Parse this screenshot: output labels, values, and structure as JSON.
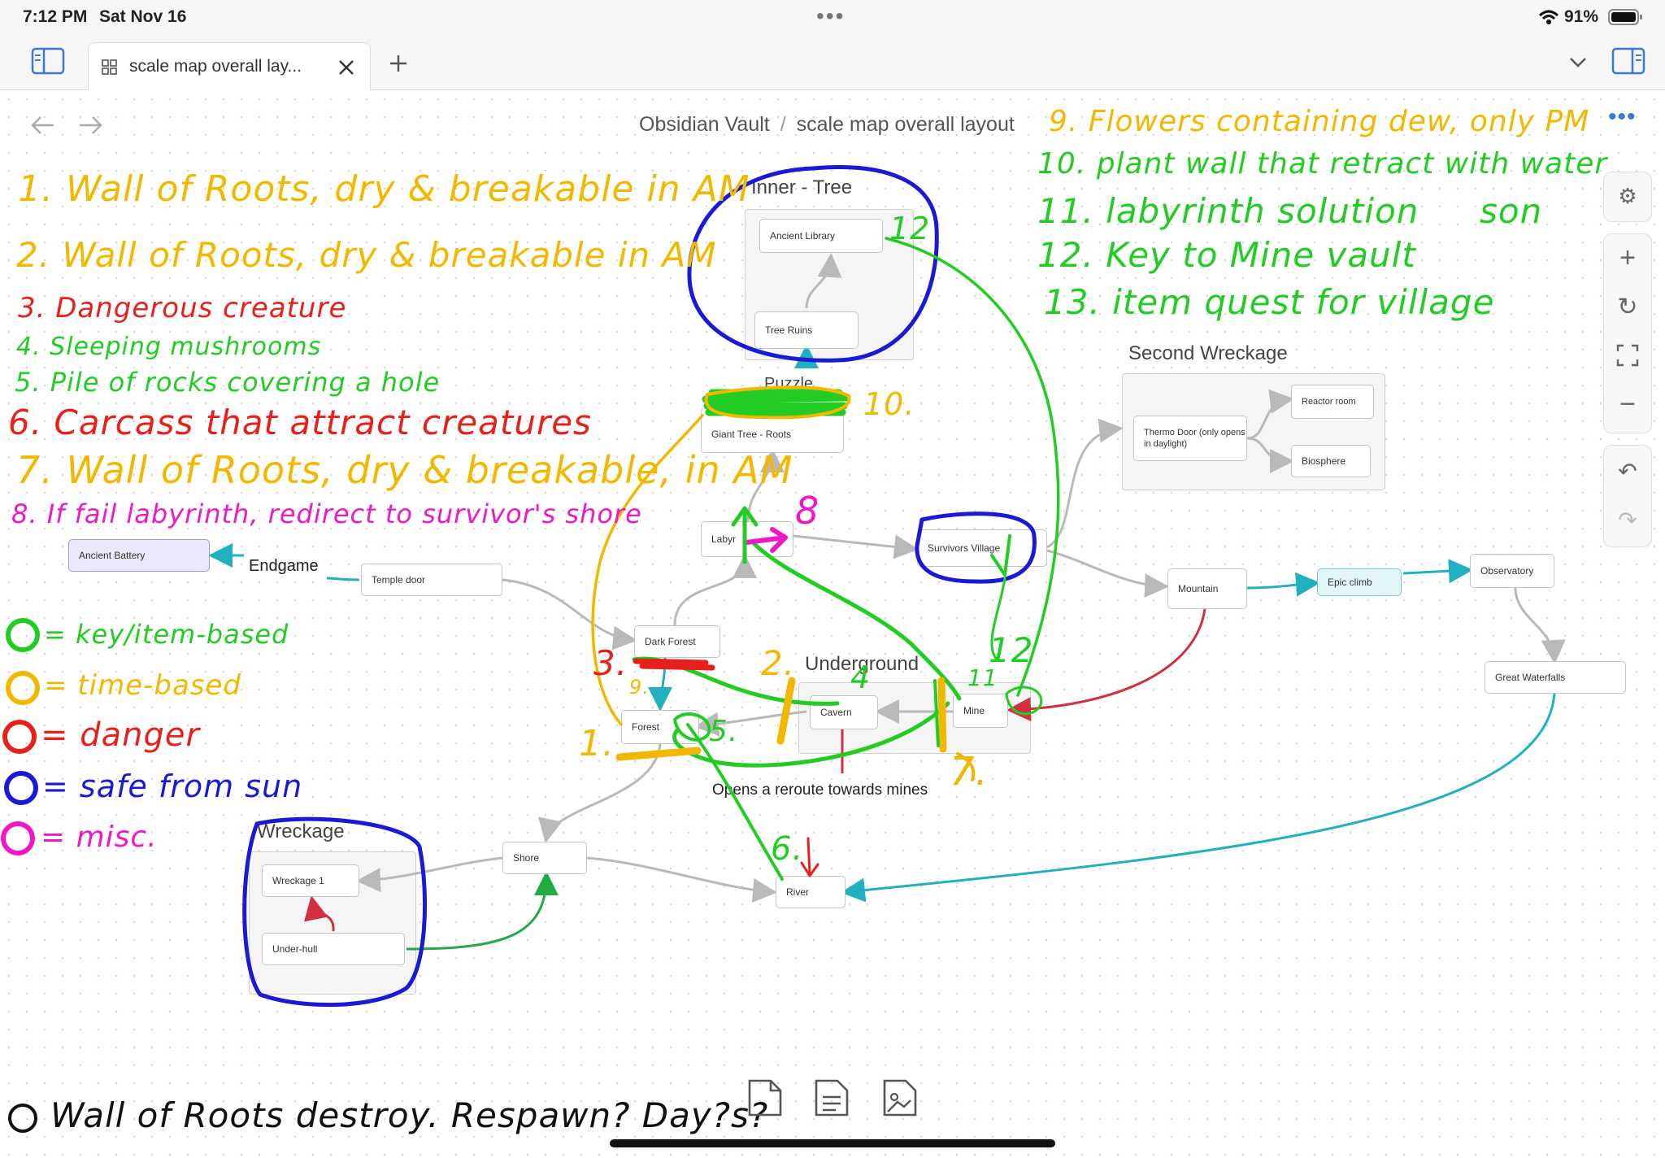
{
  "status": {
    "time": "7:12 PM",
    "date": "Sat Nov 16",
    "battery": "91%"
  },
  "tab": {
    "title": "scale map overall lay..."
  },
  "breadcrumb": {
    "vault": "Obsidian Vault",
    "separator": "/",
    "page": "scale map overall layout"
  },
  "groups": {
    "inner_tree": "Inner - Tree",
    "puzzle": "Puzzle",
    "second_wreckage": "Second Wreckage",
    "underground": "Underground",
    "wreckage": "Wreckage",
    "endgame": "Endgame"
  },
  "nodes": {
    "ancient_library": "Ancient Library",
    "tree_ruins": "Tree Ruins",
    "giant_tree_roots": "Giant Tree - Roots",
    "thermo_door": "Thermo Door (only opens in daylight)",
    "reactor_room": "Reactor room",
    "biosphere": "Biosphere",
    "labyrinth": "Labyr",
    "survivors_village": "Survivors Village",
    "ancient_battery": "Ancient Battery",
    "temple_door": "Temple door",
    "mountain": "Mountain",
    "epic_climb": "Epic climb",
    "observatory": "Observatory",
    "dark_forest": "Dark Forest",
    "cavern": "Cavern",
    "mine": "Mine",
    "great_waterfalls": "Great Waterfalls",
    "forest": "Forest",
    "shore": "Shore",
    "river": "River",
    "wreckage_1": "Wreckage 1",
    "under_hull": "Under-hull"
  },
  "canvas_text": {
    "reroute_note": "Opens a reroute towards mines"
  },
  "annotations": {
    "left": [
      "1. Wall of Roots, dry & breakable in AM",
      "2. Wall of Roots, dry & breakable in AM",
      "3. Dangerous creature",
      "4. Sleeping mushrooms",
      "5. Pile of rocks covering a hole",
      "6. Carcass that attract creatures",
      "7. Wall of Roots, dry & breakable, in AM",
      "8. If fail labyrinth, redirect to survivor's shore"
    ],
    "right": [
      "9. Flowers containing dew, only PM",
      "10. plant wall that retract with water",
      "11. labyrinth solution",
      "son",
      "12. Key to Mine vault",
      "13. item quest for village"
    ],
    "legend": [
      "= key/item-based",
      "= time-based",
      "= danger",
      "= safe from sun",
      "= misc."
    ],
    "markers": {
      "m1": "1.",
      "m2": "2.",
      "m3": "3.",
      "m4": "4",
      "m5": "5.",
      "m6": "6.",
      "m7": "7.",
      "m8": "8",
      "m9": "9.",
      "m10": "10.",
      "m11": "11",
      "m12": "12",
      "m12b": "12"
    },
    "bottom_note": "Wall of Roots destroy. Respawn? Day?s?"
  },
  "colors": {
    "green": "#22cc22",
    "yellow": "#f2b800",
    "red": "#e8201c",
    "blue": "#1a1ad6",
    "magenta": "#ee18c8",
    "teal_edge": "#20b0c0",
    "red_edge": "#d23040",
    "green_edge": "#22aa44",
    "gray_edge": "#b9b9b9"
  }
}
